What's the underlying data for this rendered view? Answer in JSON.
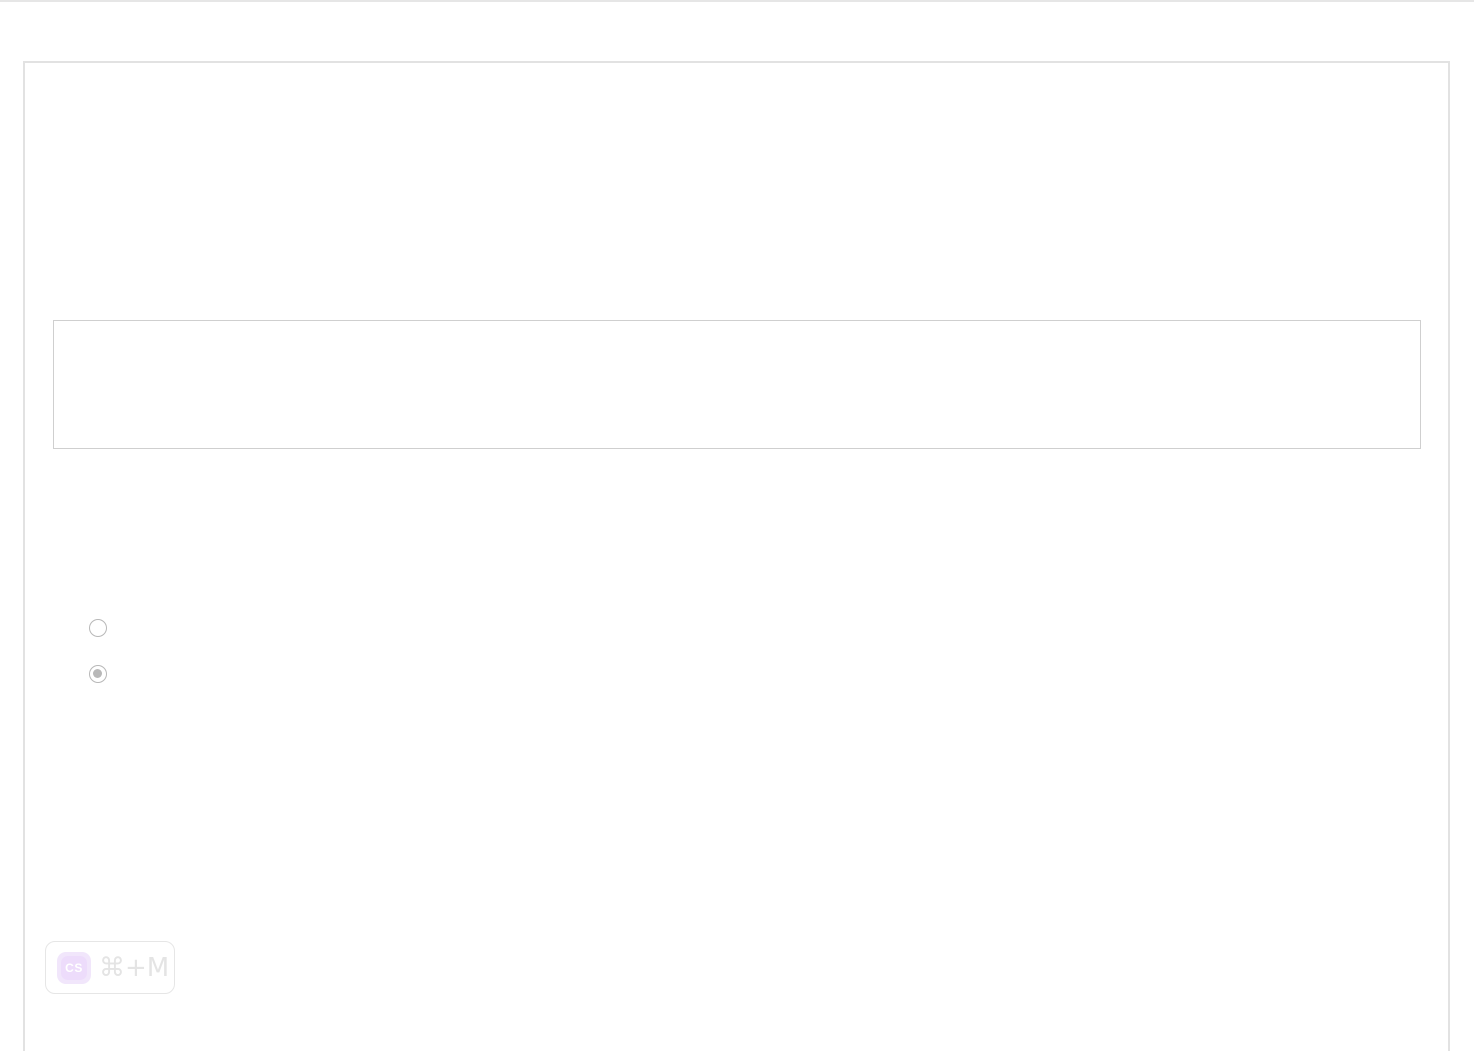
{
  "badge": {
    "logo_text": "CS",
    "shortcut": "⌘+M"
  },
  "radios": [
    {
      "checked": false
    },
    {
      "checked": true
    }
  ],
  "colors": {
    "border": "#e2e2e2",
    "box_border": "#cfcfcf",
    "radio": "#b8b8b8",
    "logo_bg": "#f1e6fb",
    "badge_text": "#e4e4e4"
  }
}
